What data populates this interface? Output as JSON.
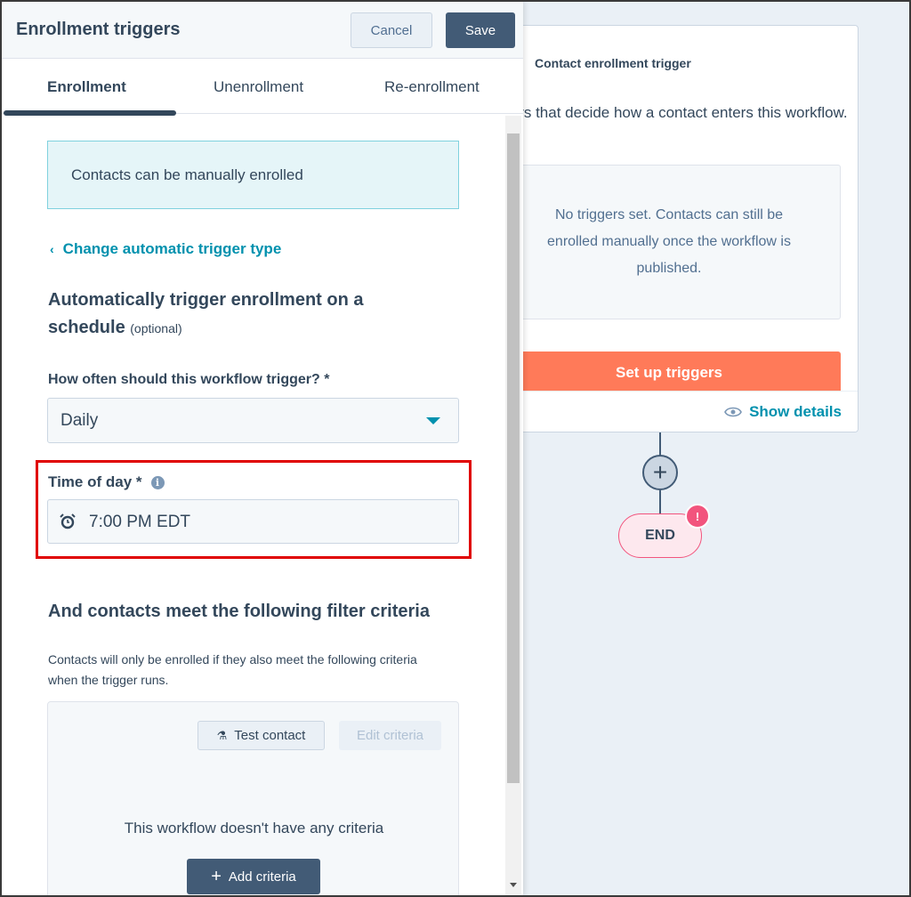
{
  "panel": {
    "title": "Enrollment triggers",
    "cancel": "Cancel",
    "save": "Save",
    "tabs": [
      {
        "label": "Enrollment",
        "active": true
      },
      {
        "label": "Unenrollment"
      },
      {
        "label": "Re-enrollment"
      }
    ],
    "notice": "Contacts can be manually enrolled",
    "change_link": "Change automatic trigger type",
    "schedule_heading": "Automatically trigger enrollment on a schedule",
    "optional": "(optional)",
    "frequency_label": "How often should this workflow trigger? *",
    "frequency_value": "Daily",
    "time_label": "Time of day *",
    "time_value": "7:00 PM EDT",
    "filter_heading": "And contacts meet the following filter criteria",
    "filter_desc": "Contacts will only be enrolled if they also meet the following criteria when the trigger runs.",
    "test_contact": "Test contact",
    "edit_criteria": "Edit criteria",
    "no_criteria": "This workflow doesn't have any criteria",
    "add_criteria": "Add criteria"
  },
  "canvas": {
    "card_title": "Contact enrollment trigger",
    "card_desc": "Choose the triggers that decide how a contact enters this workflow.",
    "empty": "No triggers set. Contacts can still be enrolled manually once the workflow is published.",
    "setup": "Set up triggers",
    "show_details": "Show details",
    "end": "END",
    "alert": "!"
  },
  "colors": {
    "primary": "#425b76",
    "accent": "#ff7a59",
    "link": "#0091ae",
    "highlight": "#e00000"
  }
}
